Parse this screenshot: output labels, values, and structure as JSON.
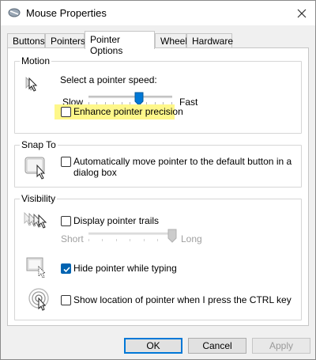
{
  "window": {
    "title": "Mouse Properties",
    "close_icon": "close-icon"
  },
  "tabs": [
    {
      "label": "Buttons",
      "active": false
    },
    {
      "label": "Pointers",
      "active": false
    },
    {
      "label": "Pointer Options",
      "active": true
    },
    {
      "label": "Wheel",
      "active": false
    },
    {
      "label": "Hardware",
      "active": false
    }
  ],
  "motion": {
    "group_label": "Motion",
    "speed_label": "Select a pointer speed:",
    "slow_label": "Slow",
    "fast_label": "Fast",
    "speed_level": 0.6,
    "enhance_label": "Enhance pointer precision",
    "enhance_checked": false,
    "icon": "pointer-speed-icon"
  },
  "snap_to": {
    "group_label": "Snap To",
    "auto_move_label_line1": "Automatically move pointer to the default button in a",
    "auto_move_label_line2": "dialog box",
    "auto_move_checked": false,
    "icon": "snap-to-icon"
  },
  "visibility": {
    "group_label": "Visibility",
    "trails_label": "Display pointer trails",
    "trails_checked": false,
    "short_label": "Short",
    "long_label": "Long",
    "trail_level": 1.0,
    "hide_label": "Hide pointer while typing",
    "hide_checked": true,
    "show_location_label": "Show location of pointer when I press the CTRL key",
    "show_location_checked": false
  },
  "buttons": {
    "ok": "OK",
    "cancel": "Cancel",
    "apply": "Apply"
  },
  "colors": {
    "accent": "#0078d7",
    "highlight": "#fef78a"
  }
}
